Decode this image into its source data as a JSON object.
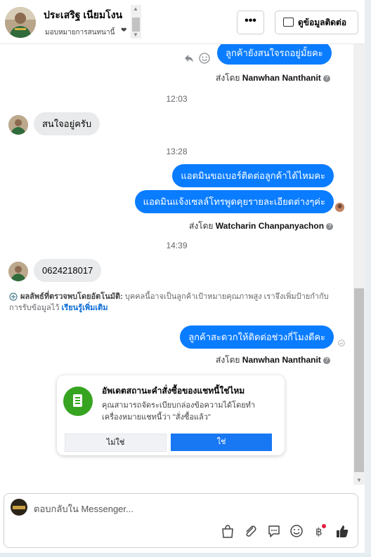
{
  "header": {
    "contact_name": "ประเสริฐ เนียมโงน",
    "assign_label": "มอบหมายการสนทนานี้",
    "more_button": "•••",
    "view_contact_button": "ดูข้อมูลติดต่อ"
  },
  "messages": [
    {
      "type": "out",
      "text": "ลูกค้ายังสนใจรถอยู่มั้ยคะ"
    },
    {
      "type": "sentby",
      "prefix": "ส่งโดย",
      "name": "Nanwhan Nanthanit"
    },
    {
      "type": "time",
      "text": "12:03"
    },
    {
      "type": "in",
      "text": "สนใจอยู่ครับ"
    },
    {
      "type": "time",
      "text": "13:28"
    },
    {
      "type": "out",
      "text": "แอดมินขอเบอร์ติดต่อลูกค้าได้ไหมคะ"
    },
    {
      "type": "out",
      "text": "แอดมินแจ้งเซลล์โทรพูดคุยรายละเอียดต่างๆค่ะ"
    },
    {
      "type": "sentby",
      "prefix": "ส่งโดย",
      "name": "Watcharin Chanpanyachon"
    },
    {
      "type": "time",
      "text": "14:39"
    },
    {
      "type": "in",
      "text": "0624218017"
    },
    {
      "type": "out",
      "text": "ลูกค้าสะดวกให้ติดต่อช่วงกี่โมงดีคะ"
    },
    {
      "type": "sentby",
      "prefix": "ส่งโดย",
      "name": "Nanwhan Nanthanit"
    }
  ],
  "auto_detect": {
    "lead": "ผลลัพธ์ที่ตรวจพบโดยอัตโนมัติ:",
    "text": "บุคคลนี้อาจเป็นลูกค้าเป้าหมายคุณภาพสูง เราจึงเพิ่มป้ายกำกับการรับข้อมูลไว้",
    "learn_more": "เรียนรู้เพิ่มเติม"
  },
  "order_card": {
    "title": "อัพเดตสถานะคำสั่งซื้อของแชทนี้ใช่ไหม",
    "description": "คุณสามารถจัดระเบียบกล่องข้อความได้โดยทำเครื่องหมายแชทนี้ว่า \"สั่งซื้อแล้ว\"",
    "no_label": "ไม่ใช่",
    "yes_label": "ใช่"
  },
  "composer": {
    "placeholder": "ตอบกลับใน Messenger..."
  },
  "colors": {
    "accent": "#0a7cff",
    "button_blue": "#1877f2",
    "order_green": "#36a420"
  },
  "icons": [
    "react-icon",
    "emoji-icon",
    "help-icon",
    "contact-card-icon",
    "shopping-bag-icon",
    "paperclip-icon",
    "chat-bubble-icon",
    "emoji-icon",
    "baht-icon",
    "thumbs-up-icon"
  ]
}
